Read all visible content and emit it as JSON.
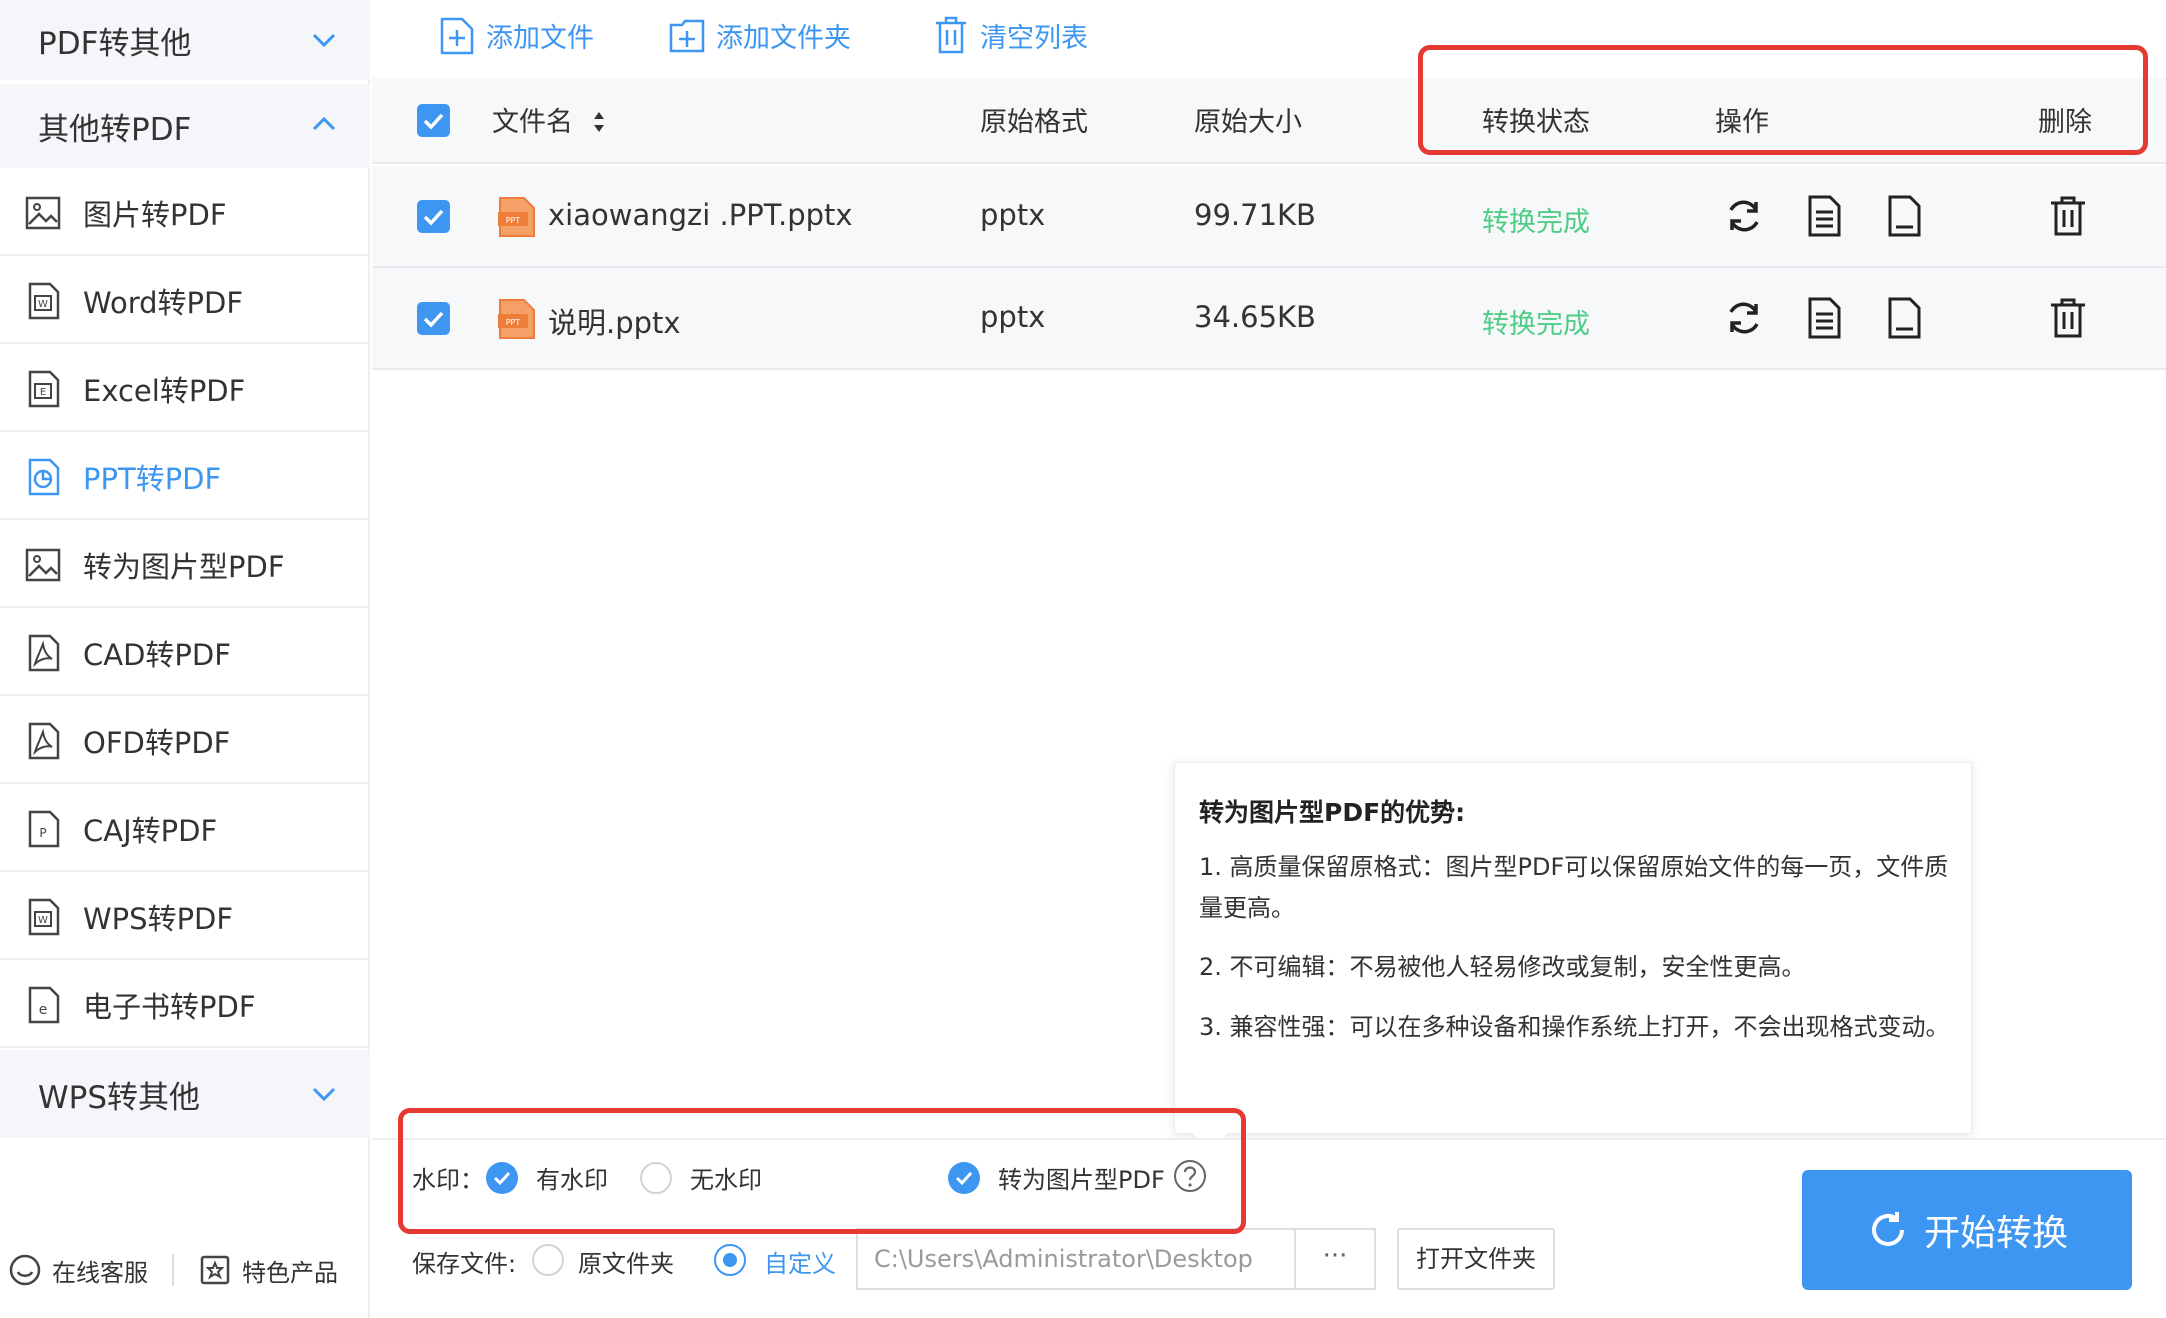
{
  "sidebar": {
    "category_pdf_to_other": "PDF转其他",
    "category_other_to_pdf": "其他转PDF",
    "items": [
      {
        "label": "图片转PDF"
      },
      {
        "label": "Word转PDF"
      },
      {
        "label": "Excel转PDF"
      },
      {
        "label": "PPT转PDF"
      },
      {
        "label": "转为图片型PDF"
      },
      {
        "label": "CAD转PDF"
      },
      {
        "label": "OFD转PDF"
      },
      {
        "label": "CAJ转PDF"
      },
      {
        "label": "WPS转PDF"
      },
      {
        "label": "电子书转PDF"
      }
    ],
    "active_item": "PPT转PDF",
    "category_wps_to_other": "WPS转其他",
    "online_service": "在线客服",
    "featured_products": "特色产品"
  },
  "toolbar": {
    "add_file": "添加文件",
    "add_folder": "添加文件夹",
    "clear_list": "清空列表"
  },
  "table": {
    "headers": {
      "filename": "文件名",
      "format": "原始格式",
      "size": "原始大小",
      "status": "转换状态",
      "actions": "操作",
      "delete": "删除"
    },
    "rows": [
      {
        "name": "xiaowangzi .PPT.pptx",
        "format": "pptx",
        "size": "99.71KB",
        "status": "转换完成",
        "checked": true
      },
      {
        "name": "说明.pptx",
        "format": "pptx",
        "size": "34.65KB",
        "status": "转换完成",
        "checked": true
      }
    ]
  },
  "tooltip": {
    "title": "转为图片型PDF的优势:",
    "points": [
      "1. 高质量保留原格式：图片型PDF可以保留原始文件的每一页，文件质量更高。",
      "2. 不可编辑：不易被他人轻易修改或复制，安全性更高。",
      "3. 兼容性强：可以在多种设备和操作系统上打开，不会出现格式变动。"
    ]
  },
  "options": {
    "watermark_label": "水印：",
    "with_watermark": "有水印",
    "no_watermark": "无水印",
    "to_image_pdf": "转为图片型PDF",
    "save_label": "保存文件:",
    "original_folder": "原文件夹",
    "custom": "自定义",
    "path_value": "C:\\Users\\Administrator\\Desktop",
    "browse": "···",
    "open_folder": "打开文件夹"
  },
  "start_button": "开始转换",
  "colors": {
    "accent": "#3d96f2",
    "status_success": "#4fcc86",
    "annotation_red": "#e53a32"
  }
}
